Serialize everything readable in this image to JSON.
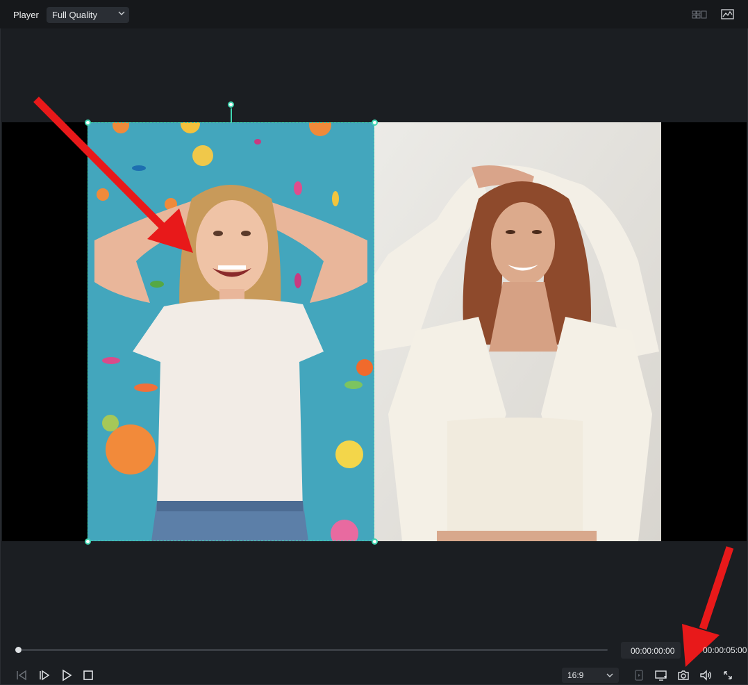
{
  "header": {
    "title": "Player",
    "quality_label": "Full Quality"
  },
  "playback": {
    "current_time": "00:00:00:00",
    "total_time": "00:00:05:00",
    "progress": 0.0,
    "aspect_ratio": "16:9"
  },
  "icons": {
    "quality_dropdown": "chevron-down-icon",
    "view_toggle": "grid-view-icon",
    "scopes": "waveform-scope-icon",
    "prev_frame": "previous-frame-icon",
    "play_frame": "play-frame-icon",
    "play": "play-icon",
    "stop": "stop-icon",
    "ratio_dropdown": "chevron-down-icon",
    "mark": "mark-in-icon",
    "display": "monitor-icon",
    "snapshot": "camera-icon",
    "volume": "speaker-icon",
    "fullscreen": "fullscreen-icon"
  },
  "colors": {
    "selection": "#3fd6b1",
    "annotation_arrow": "#e8191a",
    "background": "#1b1e22",
    "topbar": "#16181b"
  }
}
